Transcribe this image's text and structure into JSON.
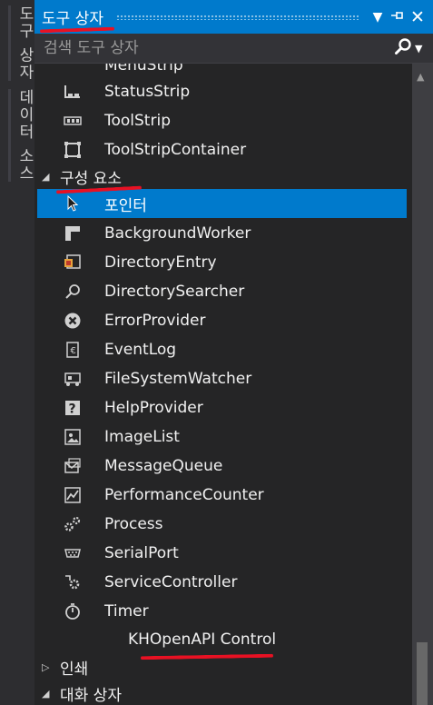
{
  "side_tabs": [
    "도구 상자",
    "데이터 소스"
  ],
  "titlebar": {
    "title": "도구 상자",
    "dropdown_icon": "▼",
    "pin_icon": "⊣",
    "close_icon": "✕"
  },
  "search": {
    "placeholder": "검색 도구 상자"
  },
  "items_top": [
    {
      "label": "MenuStrip",
      "icon": "menustrip-icon"
    },
    {
      "label": "StatusStrip",
      "icon": "statusstrip-icon"
    },
    {
      "label": "ToolStrip",
      "icon": "toolstrip-icon"
    },
    {
      "label": "ToolStripContainer",
      "icon": "toolstripcontainer-icon"
    }
  ],
  "category_components": "구성 요소",
  "components": [
    {
      "label": "포인터",
      "icon": "pointer-icon",
      "selected": true
    },
    {
      "label": "BackgroundWorker",
      "icon": "backgroundworker-icon"
    },
    {
      "label": "DirectoryEntry",
      "icon": "directoryentry-icon"
    },
    {
      "label": "DirectorySearcher",
      "icon": "directorysearcher-icon"
    },
    {
      "label": "ErrorProvider",
      "icon": "errorprovider-icon"
    },
    {
      "label": "EventLog",
      "icon": "eventlog-icon"
    },
    {
      "label": "FileSystemWatcher",
      "icon": "filesystemwatcher-icon"
    },
    {
      "label": "HelpProvider",
      "icon": "helpprovider-icon"
    },
    {
      "label": "ImageList",
      "icon": "imagelist-icon"
    },
    {
      "label": "MessageQueue",
      "icon": "messagequeue-icon"
    },
    {
      "label": "PerformanceCounter",
      "icon": "performancecounter-icon"
    },
    {
      "label": "Process",
      "icon": "process-icon"
    },
    {
      "label": "SerialPort",
      "icon": "serialport-icon"
    },
    {
      "label": "ServiceController",
      "icon": "servicecontroller-icon"
    },
    {
      "label": "Timer",
      "icon": "timer-icon"
    }
  ],
  "khopenapi_label": "KHOpenAPI Control",
  "category_print": "인쇄",
  "category_dialogs": "대화 상자",
  "annotation_color": "#e81123",
  "accent_color": "#007acc"
}
